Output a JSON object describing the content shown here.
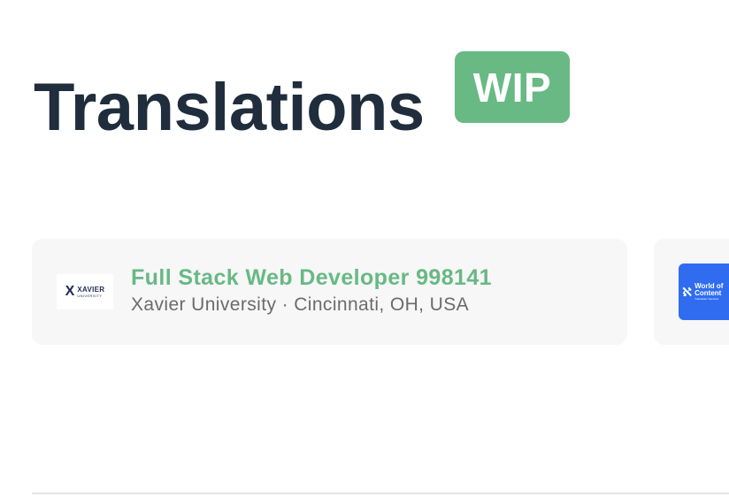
{
  "header": {
    "title": "Translations",
    "badge": "WIP"
  },
  "colors": {
    "accent": "#68b984",
    "title": "#1f2d3d",
    "muted": "#6b6b6b",
    "card_bg": "#f7f7f7",
    "woc_blue": "#2f6cf0"
  },
  "cards": [
    {
      "title": "Full Stack Web Developer 998141",
      "meta": "Xavier University · Cincinnati, OH, USA",
      "logo": {
        "icon": "xavier-university-logo",
        "mark": "X",
        "wordmark": "XAVIER",
        "subtext": "UNIVERSITY"
      }
    },
    {
      "logo": {
        "icon": "world-of-content-logo",
        "mark": "ℵ",
        "line1": "World of",
        "line2": "Content",
        "subtext": "Translation Services"
      }
    }
  ]
}
